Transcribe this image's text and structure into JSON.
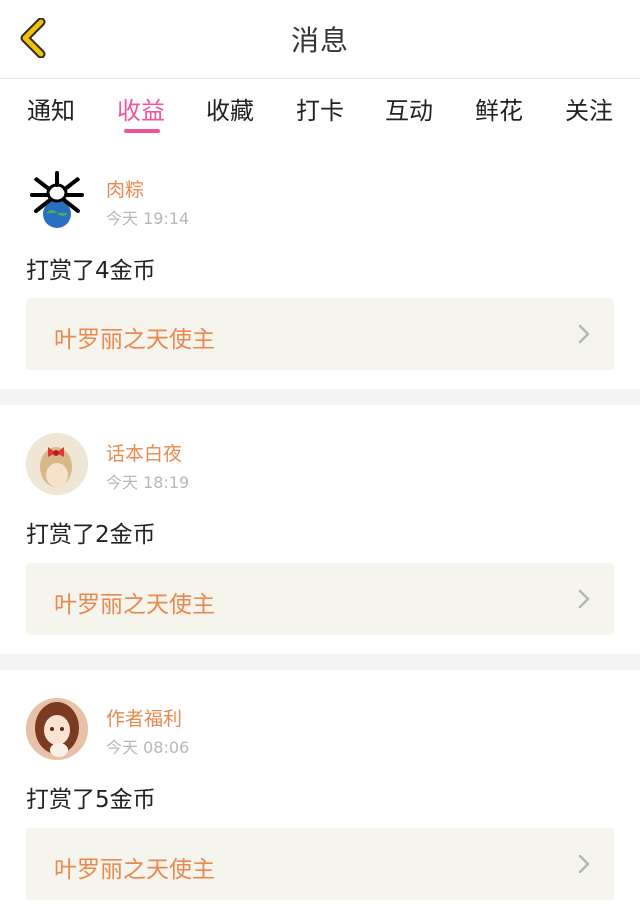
{
  "header": {
    "title": "消息",
    "back_icon": "chevron-left-icon"
  },
  "tabs": [
    {
      "label": "通知",
      "active": false
    },
    {
      "label": "收益",
      "active": true
    },
    {
      "label": "收藏",
      "active": false
    },
    {
      "label": "打卡",
      "active": false
    },
    {
      "label": "互动",
      "active": false
    },
    {
      "label": "鲜花",
      "active": false
    },
    {
      "label": "关注",
      "active": false
    }
  ],
  "messages": [
    {
      "user": "肉粽",
      "time": "今天 19:14",
      "action": "打赏了4金币",
      "work": "叶罗丽之天使主"
    },
    {
      "user": "话本白夜",
      "time": "今天 18:19",
      "action": "打赏了2金币",
      "work": "叶罗丽之天使主"
    },
    {
      "user": "作者福利",
      "time": "今天 08:06",
      "action": "打赏了5金币",
      "work": "叶罗丽之天使主"
    }
  ],
  "colors": {
    "accent": "#f0559b",
    "username": "#e8894f",
    "link_bg": "#f5f5ee",
    "back_icon": "#e6b800"
  }
}
